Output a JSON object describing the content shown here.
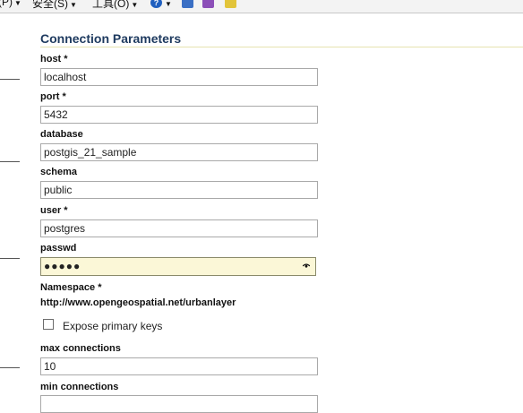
{
  "toolbar": {
    "items": [
      {
        "label": "(P)"
      },
      {
        "label": "安全(S)"
      },
      {
        "label": "工具(O)"
      }
    ],
    "icons": [
      "help-icon",
      "research-icon",
      "messenger-icon",
      "shield-star-icon"
    ]
  },
  "section": {
    "title": "Connection Parameters"
  },
  "fields": {
    "host": {
      "label": "host *",
      "value": "localhost"
    },
    "port": {
      "label": "port *",
      "value": "5432"
    },
    "database": {
      "label": "database",
      "value": "postgis_21_sample"
    },
    "schema": {
      "label": "schema",
      "value": "public"
    },
    "user": {
      "label": "user *",
      "value": "postgres"
    },
    "passwd": {
      "label": "passwd",
      "value": "●●●●●"
    }
  },
  "namespace": {
    "label": "Namespace *",
    "value": "http://www.opengeospatial.net/urbanlayer"
  },
  "expose_pk": {
    "label": "Expose primary keys",
    "checked": false
  },
  "max_connections": {
    "label": "max connections",
    "value": "10"
  },
  "min_connections": {
    "label": "min connections"
  }
}
